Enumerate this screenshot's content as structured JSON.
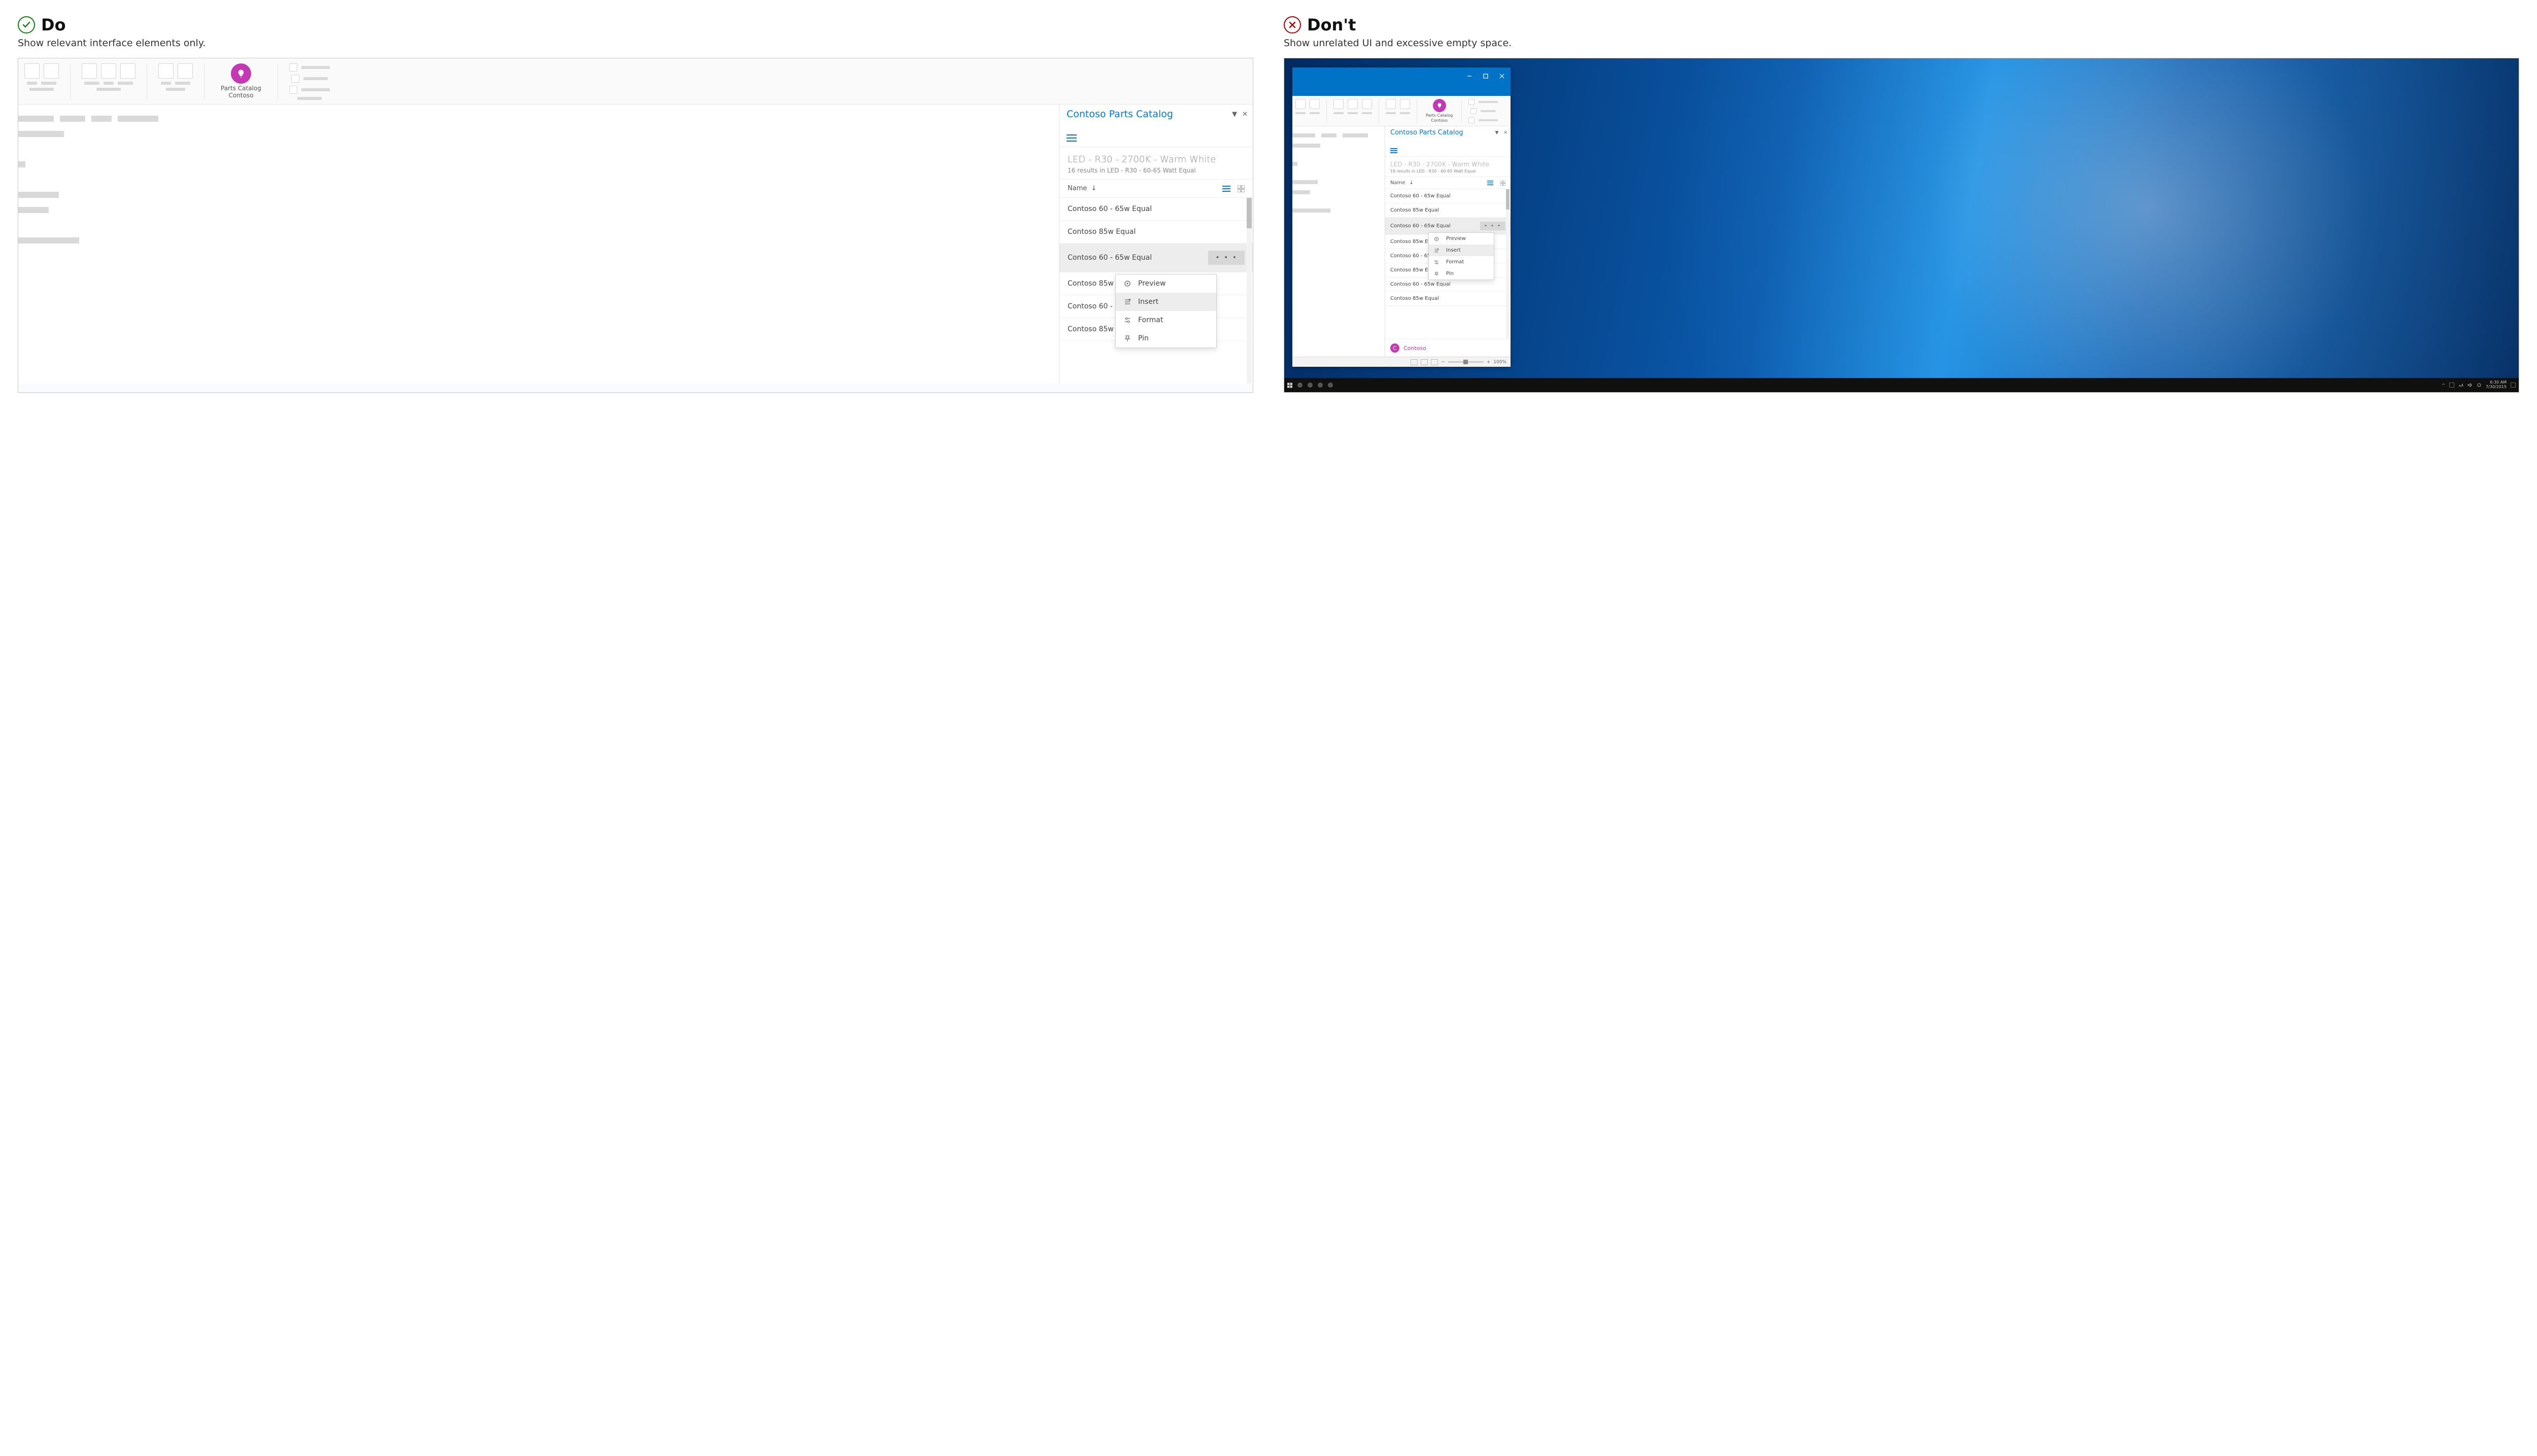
{
  "do": {
    "title": "Do",
    "caption": "Show relevant interface elements only.",
    "addin": {
      "button_line1": "Parts Catalog",
      "button_line2": "Contoso"
    },
    "pane": {
      "title": "Contoso Parts Catalog",
      "query_title": "LED - R30 - 2700K - Warm White",
      "query_sub": "16 results in LED - R30 - 60-65 Watt Equal",
      "col_name": "Name",
      "items": [
        "Contoso 60 - 65w Equal",
        "Contoso 85w Equal",
        "Contoso 60 - 65w Equal",
        "Contoso 85w Eq",
        "Contoso 60 - 65",
        "Contoso 85w Eq"
      ],
      "selected_index": 2
    },
    "menu": {
      "preview": "Preview",
      "insert": "Insert",
      "format": "Format",
      "pin": "Pin"
    }
  },
  "dont": {
    "title": "Don't",
    "caption": "Show unrelated UI and excessive empty space.",
    "addin": {
      "button_line1": "Parts Catalog",
      "button_line2": "Contoso"
    },
    "pane": {
      "title": "Contoso Parts Catalog",
      "query_title": "LED - R30 - 2700K - Warm White",
      "query_sub": "16 results in LED - R30 - 60-65 Watt Equal",
      "col_name": "Name",
      "items": [
        "Contoso 60 - 65w Equal",
        "Contoso 85w Equal",
        "Contoso 60 - 65w Equal",
        "Contoso 85w Equal",
        "Contoso 60 - 65",
        "Contoso 85w Eq",
        "Contoso 60 - 65w Equal",
        "Contoso 85w Equal"
      ],
      "selected_index": 2,
      "brand": "Contoso"
    },
    "menu": {
      "preview": "Preview",
      "insert": "Insert",
      "format": "Format",
      "pin": "Pin"
    },
    "statusbar": {
      "zoom": "100%"
    },
    "taskbar": {
      "time": "6:30 AM",
      "date": "7/30/2015"
    }
  },
  "colors": {
    "accent": "#0078d4",
    "brand": "#c239b3",
    "do": "#107c10",
    "dont": "#a80000"
  }
}
